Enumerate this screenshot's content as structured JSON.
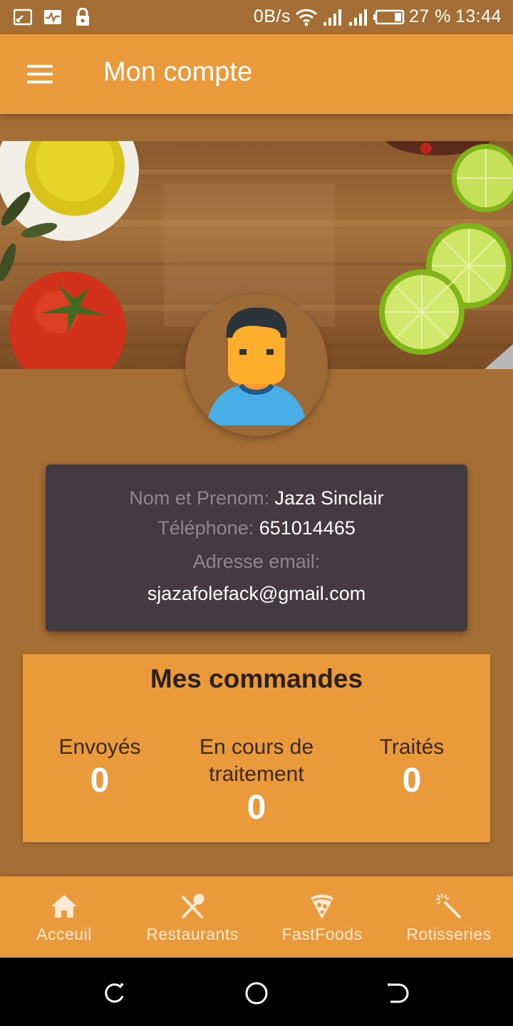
{
  "status_bar": {
    "network_speed": "0B/s",
    "battery": "27 %",
    "time": "13:44",
    "icons": [
      "cast-icon",
      "activity-icon",
      "lock-icon",
      "wifi-icon",
      "signal-icon",
      "signal-icon-2",
      "battery-icon"
    ]
  },
  "app_bar": {
    "title": "Mon compte",
    "menu_icon": "menu-icon"
  },
  "profile": {
    "name_label": "Nom et Prenom: ",
    "name_value": "Jaza Sinclair",
    "phone_label": "Téléphone: ",
    "phone_value": "651014465",
    "email_label": "Adresse email:",
    "email_value": "sjazafolefack@gmail.com"
  },
  "orders": {
    "title": "Mes commandes",
    "sent_label": "Envoyés",
    "sent_count": "0",
    "in_progress_label_1": "En cours de",
    "in_progress_label_2": "traitement",
    "in_progress_count": "0",
    "done_label": "Traités",
    "done_count": "0"
  },
  "bottom_nav": {
    "items": [
      {
        "label": "Acceuil",
        "icon": "home-icon"
      },
      {
        "label": "Restaurants",
        "icon": "utensils-icon"
      },
      {
        "label": "FastFoods",
        "icon": "pizza-icon"
      },
      {
        "label": "Rotisseries",
        "icon": "magic-wand-icon"
      }
    ]
  },
  "colors": {
    "primary": "#ea993b",
    "background": "#a56e34",
    "card": "#433a42"
  }
}
